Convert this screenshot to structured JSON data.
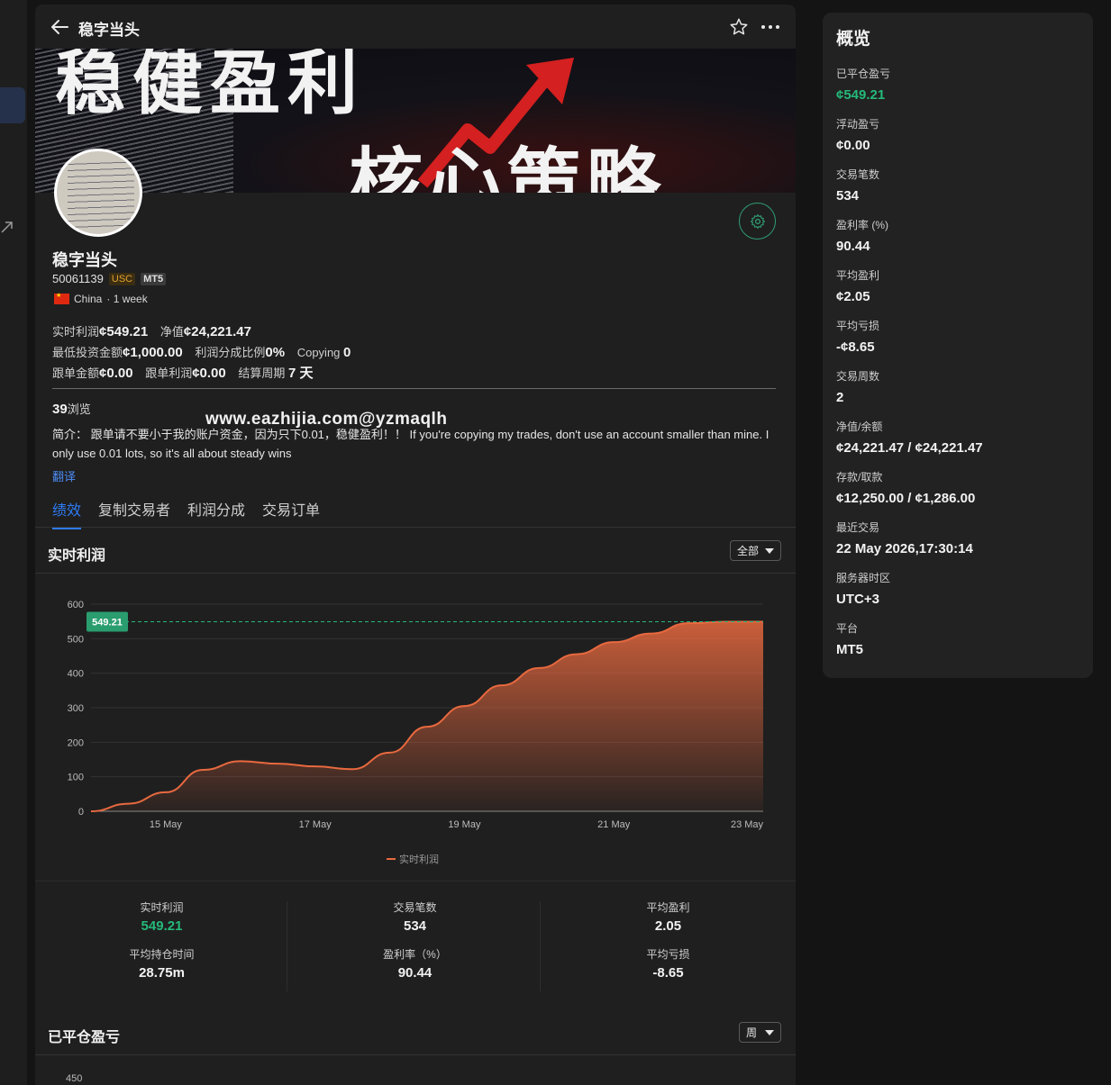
{
  "topbar": {
    "title": "稳字当头"
  },
  "banner": {
    "line1": "稳健盈利",
    "line2": "核心策略"
  },
  "profile": {
    "name": "稳字当头",
    "account_id": "50061139",
    "currency_badge": "USC",
    "platform_badge": "MT5",
    "country": "China",
    "age": "· 1 week"
  },
  "stats": {
    "realtime_profit_label": "实时利润",
    "realtime_profit": "¢549.21",
    "equity_label": "净值",
    "equity": "¢24,221.47",
    "min_invest_label": "最低投资金额",
    "min_invest": "¢1,000.00",
    "share_ratio_label": "利润分成比例",
    "share_ratio": "0%",
    "copying_label": "Copying",
    "copying": "0",
    "follow_amount_label": "跟单金额",
    "follow_amount": "¢0.00",
    "follow_profit_label": "跟单利润",
    "follow_profit": "¢0.00",
    "settle_label": "结算周期",
    "settle": "7 天"
  },
  "views": {
    "count": "39",
    "label": "浏览"
  },
  "watermark": "www.eazhijia.com@yzmaqlh",
  "intro": "简介：  跟单请不要小于我的账户资金，因为只下0.01，稳健盈利！！  If you're copying my trades, don't use an account smaller than mine. I only use 0.01 lots, so it's all about steady wins",
  "translate": "翻译",
  "tabs": [
    "绩效",
    "复制交易者",
    "利润分成",
    "交易订单"
  ],
  "sections": {
    "profit_title": "实时利润",
    "profit_filter": "全部",
    "closed_title": "已平仓盈亏",
    "closed_filter": "周",
    "closed_axis_first": "450"
  },
  "chart_data": {
    "type": "area",
    "x": [
      "14 May",
      "14.5 May",
      "15 May",
      "15.5 May",
      "16 May",
      "16.5 May",
      "17 May",
      "17.5 May",
      "18 May",
      "18.5 May",
      "19 May",
      "19.5 May",
      "20 May",
      "20.5 May",
      "21 May",
      "21.5 May",
      "22 May",
      "22.5 May",
      "23 May"
    ],
    "x_ticks": [
      "15 May",
      "17 May",
      "19 May",
      "21 May",
      "23 May"
    ],
    "y_ticks": [
      0,
      100,
      200,
      300,
      400,
      500,
      600
    ],
    "ylim": [
      0,
      600
    ],
    "series": [
      {
        "name": "实时利润",
        "values": [
          0,
          22,
          55,
          120,
          145,
          138,
          130,
          122,
          170,
          245,
          305,
          365,
          415,
          455,
          490,
          515,
          545,
          549,
          549.21
        ]
      }
    ],
    "current_value_label": "549.21",
    "color": "#e8693f"
  },
  "metrics": [
    {
      "label": "实时利润",
      "value": "549.21",
      "green": true
    },
    {
      "label": "平均持仓时间",
      "value": "28.75m"
    },
    {
      "label": "交易笔数",
      "value": "534"
    },
    {
      "label": "盈利率（%）",
      "value": "90.44"
    },
    {
      "label": "平均盈利",
      "value": "2.05"
    },
    {
      "label": "平均亏损",
      "value": "-8.65"
    }
  ],
  "overview": {
    "title": "概览",
    "items": [
      {
        "label": "已平仓盈亏",
        "value": "¢549.21",
        "green": true
      },
      {
        "label": "浮动盈亏",
        "value": "¢0.00"
      },
      {
        "label": "交易笔数",
        "value": "534"
      },
      {
        "label": "盈利率 (%)",
        "value": "90.44"
      },
      {
        "label": "平均盈利",
        "value": "¢2.05"
      },
      {
        "label": "平均亏损",
        "value": "-¢8.65"
      },
      {
        "label": "交易周数",
        "value": "2"
      },
      {
        "label": "净值/余额",
        "value": "¢24,221.47 / ¢24,221.47"
      },
      {
        "label": "存款/取款",
        "value": "¢12,250.00 / ¢1,286.00"
      },
      {
        "label": "最近交易",
        "value": "22 May 2026,17:30:14"
      },
      {
        "label": "服务器时区",
        "value": "UTC+3"
      },
      {
        "label": "平台",
        "value": "MT5"
      }
    ]
  },
  "colors": {
    "accent": "#2e7cf6",
    "positive": "#25b97a",
    "series": "#e8693f",
    "usc": "#e3a22e"
  }
}
